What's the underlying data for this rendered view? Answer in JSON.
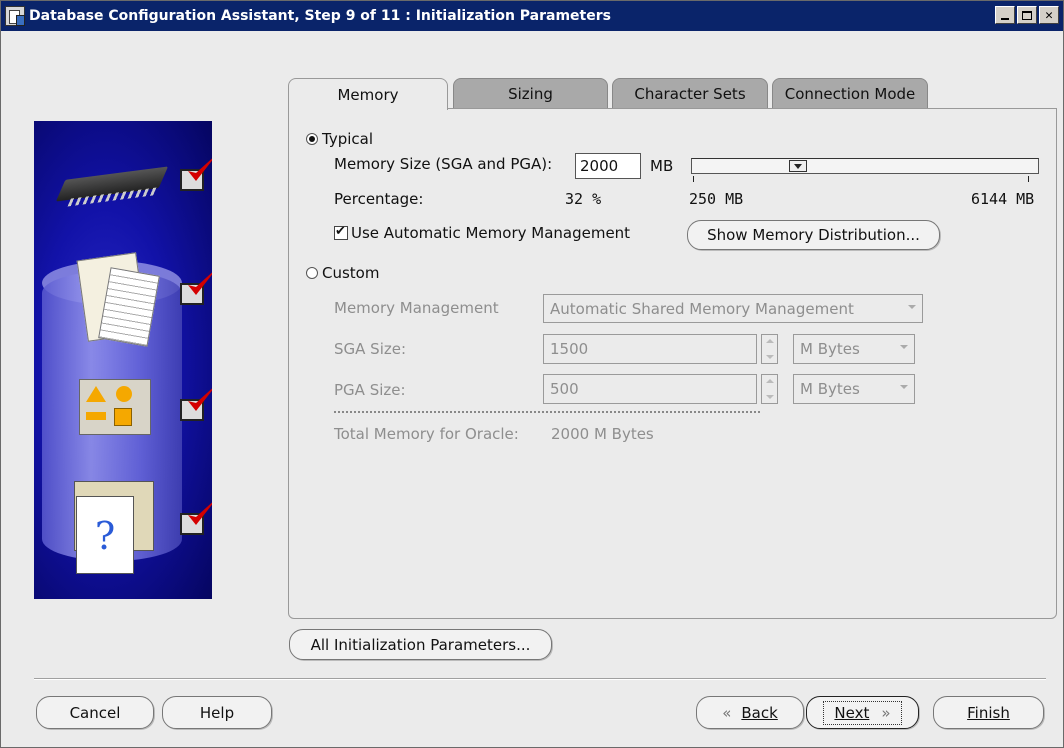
{
  "window": {
    "title": "Database Configuration Assistant, Step 9 of 11 : Initialization Parameters"
  },
  "tabs": [
    {
      "label": "Memory",
      "active": true
    },
    {
      "label": "Sizing",
      "active": false
    },
    {
      "label": "Character Sets",
      "active": false
    },
    {
      "label": "Connection Mode",
      "active": false
    }
  ],
  "memory": {
    "typical_label": "Typical",
    "typical_selected": true,
    "memory_size_label": "Memory Size (SGA and PGA):",
    "memory_size_value": "2000",
    "memory_size_unit": "MB",
    "percentage_label": "Percentage:",
    "percentage_value": "32 %",
    "slider_min": "250 MB",
    "slider_max": "6144 MB",
    "slider_level": 0.32,
    "amm_label": "Use Automatic Memory Management",
    "amm_checked": true,
    "show_distribution_label": "Show Memory Distribution...",
    "custom_label": "Custom",
    "custom_selected": false,
    "memory_management_label": "Memory Management",
    "memory_management_value": "Automatic Shared Memory Management",
    "sga_label": "SGA Size:",
    "sga_value": "1500",
    "sga_unit": "M Bytes",
    "pga_label": "PGA Size:",
    "pga_value": "500",
    "pga_unit": "M Bytes",
    "total_label": "Total Memory for Oracle:",
    "total_value": "2000 M Bytes"
  },
  "buttons": {
    "all_params": "All Initialization Parameters...",
    "cancel": "Cancel",
    "help": "Help",
    "back_arrow": "«",
    "back_label": "Back",
    "next_label": "Next",
    "next_arrow": "»",
    "finish": "Finish"
  },
  "colors": {
    "titlebar": "#0a246a",
    "side_art": "#1212a8",
    "check_red": "#d40000"
  }
}
